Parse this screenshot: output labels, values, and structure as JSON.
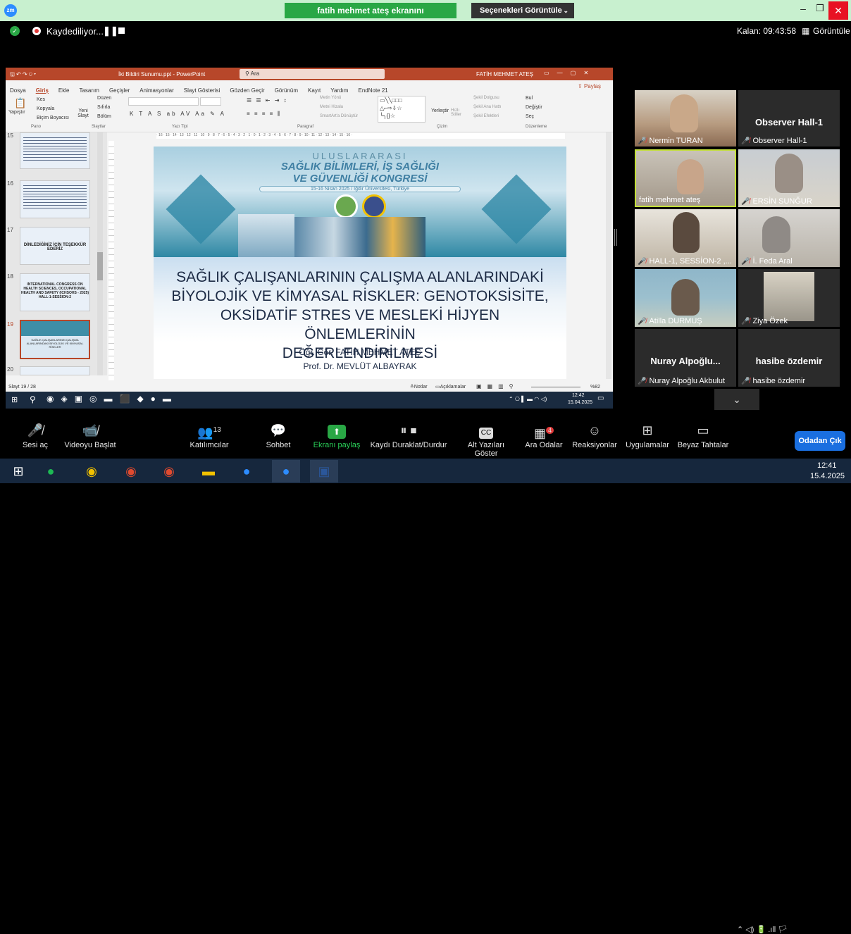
{
  "topbar": {
    "zoom_icon": "zm",
    "share_banner": "fatih mehmet ateş ekranını görüntülüyorsunuz",
    "share_options": "Seçenekleri Görüntüle",
    "recording": "Kaydediliyor...",
    "remaining": "Kalan: 09:43:58",
    "view_label": "Görüntüle"
  },
  "ppt": {
    "title": "İki Bildiri Sunumu.ppt - PowerPoint",
    "search": "Ara",
    "user": "FATİH MEHMET ATEŞ",
    "tabs": [
      "Dosya",
      "Giriş",
      "Ekle",
      "Tasarım",
      "Geçişler",
      "Animasyonlar",
      "Slayt Gösterisi",
      "Gözden Geçir",
      "Görünüm",
      "Kayıt",
      "Yardım",
      "EndNote 21"
    ],
    "share": "Paylaş",
    "groups": [
      "Pano",
      "Slaytlar",
      "Yazı Tipi",
      "Paragraf",
      "Çizim",
      "Düzenleme"
    ],
    "ribbon_items": {
      "paste": "Yapıştır",
      "cut": "Kes",
      "copy": "Kopyala",
      "format_painter": "Biçim Boyacısı",
      "new_slide": "Yeni Slayt",
      "layout": "Düzen",
      "reset": "Sıfırla",
      "section": "Bölüm",
      "text_direction": "Metin Yönü",
      "align_text": "Metni Hizala",
      "smartart": "SmartArt'a Dönüştür",
      "arrange": "Yerleştir",
      "quick_styles": "Hızlı Stiller",
      "shape_fill": "Şekil Dolgusu",
      "shape_outline": "Şekil Ana Hattı",
      "shape_effects": "Şekil Efektleri",
      "find": "Bul",
      "replace": "Değiştir",
      "select": "Seç"
    },
    "ruler": "· 16 · 15 · 14 · 13 · 12 · 11 · 10 · 9 · 8 · 7 · 6 · 5 · 4 · 3 · 2 · 1 · 0 · 1 · 2 · 3 · 4 · 5 · 6 · 7 · 8 · 9 · 10 · 11 · 12 · 13 · 14 · 15 · 16 ·",
    "thumbnails": [
      {
        "no": "15",
        "text": ""
      },
      {
        "no": "16",
        "text": ""
      },
      {
        "no": "17",
        "text": "DİNLEDİĞİNİZ İÇİN TEŞEKKÜR EDERİZ"
      },
      {
        "no": "18",
        "text": "INTERNATIONAL CONGRESS ON HEALTH SCIENCES, OCCUPATIONAL HEALTH AND SAFETY (ICHSOHS - 2025) HALL-1-SESSION-2"
      },
      {
        "no": "19",
        "text": "SAĞLIK ÇALIŞANLARININ ÇALIŞMA ALANLARINDAKİ BİYOLOJİK VE KİMYASAL RİSKLER"
      },
      {
        "no": "20",
        "text": ""
      }
    ],
    "slide": {
      "congress_line1": "ULUSLARARASI",
      "congress_line2": "SAĞLIK BİLİMLERİ, İŞ SAĞLIĞI",
      "congress_line3": "VE GÜVENLİĞİ KONGRESİ",
      "congress_date": "15-16 Nisan 2025 / Iğdır Üniversitesi, Türkiye",
      "title_lines": [
        "SAĞLIK ÇALIŞANLARININ ÇALIŞMA ALANLARINDAKİ",
        "BİYOLOJİK VE KİMYASAL RİSKLER: GENOTOKSİSİTE,",
        "OKSİDATİF STRES VE MESLEKİ HİJYEN ÖNLEMLERİNİN",
        "DEĞERLENDİRİLMESİ"
      ],
      "author1": "Öğr. Gör. FATİH MEHMET ATEŞ",
      "author2": "Prof. Dr. MEVLÜT ALBAYRAK"
    },
    "status": {
      "slide_count": "Slayt 19 / 28",
      "notes": "Notlar",
      "comments": "Açıklamalar",
      "zoom": "%82"
    },
    "clock": {
      "time": "12:42",
      "date": "15.04.2025"
    }
  },
  "participants": [
    {
      "name": "Nermin TURAN",
      "video": true,
      "tone": "#c9a889"
    },
    {
      "name": "Observer Hall-1",
      "video": false,
      "tone": ""
    },
    {
      "name": "fatih mehmet ateş",
      "video": true,
      "tone": "#c8a58a",
      "active": true
    },
    {
      "name": "ERSİN SUNĞUR",
      "video": true,
      "tone": "#9a8f86"
    },
    {
      "name": "HALL-1, SESSİON-2 ,...",
      "video": true,
      "tone": "#5a4a3e"
    },
    {
      "name": "İ. Feda Aral",
      "video": true,
      "tone": "#8f8a86"
    },
    {
      "name": "Atilla DURMUŞ",
      "video": true,
      "tone": "#8aa9b5"
    },
    {
      "name": "Ziya Özek",
      "video": true,
      "tone": "#b0a898"
    },
    {
      "name": "Nuray Alpoğlu Akbulut",
      "video": false,
      "display": "Nuray  Alpoğlu...",
      "tone": ""
    },
    {
      "name": "hasibe özdemir",
      "video": false,
      "tone": ""
    }
  ],
  "controls": [
    {
      "label": "Sesi aç",
      "icon": "🎤",
      "badge": ""
    },
    {
      "label": "Videoyu Başlat",
      "icon": "📹",
      "badge": ""
    },
    {
      "label": "Katılımcılar",
      "icon": "👥",
      "badge": "13"
    },
    {
      "label": "Sohbet",
      "icon": "💬",
      "badge": ""
    },
    {
      "label": "Ekranı paylaş",
      "icon": "⬆",
      "badge": ""
    },
    {
      "label": "Kaydı Duraklat/Durdur",
      "icon": "⏸",
      "badge": ""
    },
    {
      "label": "Alt Yazıları Göster",
      "icon": "CC",
      "badge": ""
    },
    {
      "label": "Ara Odalar",
      "icon": "▦",
      "badge": "4"
    },
    {
      "label": "Reaksiyonlar",
      "icon": "☺",
      "badge": ""
    },
    {
      "label": "Uygulamalar",
      "icon": "⊞",
      "badge": ""
    },
    {
      "label": "Beyaz Tahtalar",
      "icon": "▭",
      "badge": ""
    }
  ],
  "end_button": "Odadan Çık",
  "taskbar": {
    "time": "12:41",
    "date": "15.4.2025"
  },
  "colors": {
    "accent_green": "#29a745",
    "ppt_red": "#b7472a",
    "zoom_blue": "#1a6fe0",
    "muted_red": "#e23b3b"
  }
}
